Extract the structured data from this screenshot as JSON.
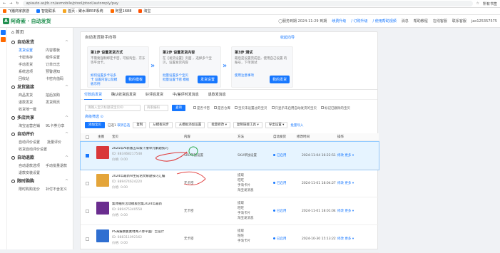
{
  "browser": {
    "url": "apiauto.asjtb.cn/asmobile/ptool/ptool/autoreply/pay",
    "right_label": "所有书签"
  },
  "bookmarks": [
    {
      "label": "飞猪商家旅游",
      "color": "#ff6a00"
    },
    {
      "label": "智能联系",
      "color": "#1677ff"
    },
    {
      "label": "首页 - 聚水潭ERP系统",
      "color": "#f5a623"
    },
    {
      "label": "阿里1688",
      "color": "#ff6a00"
    },
    {
      "label": "淘宝",
      "color": "#ff5000"
    }
  ],
  "app": {
    "logo_text": "阿奇索 · 自动发货",
    "top_links": [
      {
        "label": "◯服务到期 2024-11-29 到期",
        "blue": false
      },
      {
        "label": "续费升级",
        "blue": true
      },
      {
        "label": "/ 订购升级",
        "blue": true
      },
      {
        "label": "/ 使用帮助视频",
        "blue": true
      },
      {
        "label": "消息",
        "blue": false
      },
      {
        "label": "帮助教程",
        "blue": false
      },
      {
        "label": "在线客服",
        "blue": false
      },
      {
        "label": "联系客服",
        "blue": false
      },
      {
        "label": "jao125357575",
        "blue": false
      }
    ]
  },
  "sidebar": {
    "home": "首页",
    "sections": [
      {
        "title": "自动发货",
        "items": [
          "发货设置",
          "内容模板",
          "卡密库存",
          "组件设置",
          "手动发货",
          "订单日志",
          "系统选项",
          "预警通知",
          "回收站",
          "卡密充值码"
        ],
        "active": 0
      },
      {
        "title": "发货链接",
        "items": [
          "商品发货",
          "拍后加购",
          "退款发货",
          "发货网页",
          "收货地一键"
        ],
        "active": -1
      },
      {
        "title": "多店共享",
        "items": [
          "淘宝运营店铺",
          "91卡券分享"
        ],
        "active": -1
      },
      {
        "title": "自动评价",
        "items": [
          "自动评价设置",
          "批量评价",
          "收货自动评价设置"
        ],
        "active": -1
      },
      {
        "title": "自动退款",
        "items": [
          "自动退款选项",
          "手动批量退款",
          "退款安装设置"
        ],
        "active": -1
      },
      {
        "title": "限时购购",
        "items": [
          "限时购购定价",
          "补付不含定义"
        ],
        "active": -1
      }
    ]
  },
  "guide": {
    "title": "自动发货新手向导",
    "fold": "收起向导",
    "steps": [
      {
        "title": "第1步 设置发货方式",
        "desc": "不需要强制绑定卡密，可按淘宝、京东 等平台卡。",
        "link": "如何设置多卡号多卡 设置内容以及模板示例",
        "btn": "我的模板"
      },
      {
        "title": "第2步 设置发货内容",
        "desc": "在【发货设置】页面 ，选择多个宝贝，设置发货内容",
        "link": "批量设置多个宝贝 批量设置卡密 模板",
        "btn": "发货设置"
      },
      {
        "title": "第3步 测试",
        "desc": "最后是设置完成后，使用自己设置 的账号，下单测试",
        "link": "使用注意事项",
        "btn": "我的发货"
      }
    ]
  },
  "tabs": [
    "付款后发货",
    "确认收货后发货",
    "好评后发货",
    "中/差评时发消息",
    "退款发消息"
  ],
  "edit_template": "内容模板",
  "filters": {
    "search1": "请输入宝贝标题或宝贝ID",
    "search2": "商家编码",
    "search_btn": "查询",
    "checks": [
      "是否卡密",
      "是否仓库",
      "宝贝未设置过的宝贝",
      "只显示未启用自动发货的宝贝",
      "标记已删除的宝贝"
    ],
    "more": "高级筛选 ⊙"
  },
  "toolbar": {
    "sync": "添加宝贝",
    "count_label": "已选1",
    "count_link": "取消已选",
    "buttons": [
      "复制",
      "从模板同步",
      "从模板添加设置",
      "批量修改 ▾",
      "复制链接工具 ▾",
      "导出设置 ▾"
    ],
    "import": "批量导入"
  },
  "table": {
    "headers": [
      "主图",
      "宝贝",
      "内容",
      "方法",
      "自动发货",
      "修改时间",
      "操作"
    ],
    "rows": [
      {
        "title": "2025年AI新版五年级下册单元解题技巧",
        "id": "ID: 883468217548",
        "price": "价格: 0.00",
        "content": "SKU单独设置",
        "method": "SKU单独设置",
        "status": "已启用",
        "time": "2024-11-04 16:22:51",
        "ops": "修改  更多 ▾",
        "selected": true,
        "thumb": "#d9383a"
      },
      {
        "title": "2024年最新AI生成语文解题技巧汇编",
        "id": "ID: 889474624220",
        "price": "价格: 0.00",
        "content": "无卡密",
        "method": "提取\n旺旺\n手淘卡片\n淘宝发消息",
        "status": "已启用",
        "time": "2024-11-01 18:04:27",
        "ops": "修改  更多 ▾",
        "selected": false,
        "thumb": "#e4a53a"
      },
      {
        "title": "集体抽奖活动模板合集2024年最新",
        "id": "ID: 889475340558",
        "price": "价格: 0.00",
        "content": "无卡密",
        "method": "提取\n旺旺\n手淘卡片\n淘宝发消息",
        "status": "已启用",
        "time": "2024-11-01 18:01:04",
        "ops": "修改  更多 ▾",
        "selected": false,
        "thumb": "#6a2d8f"
      },
      {
        "title": "PS海报模板素材两人修平面广告设计",
        "id": "ID: 888311092162",
        "price": "价格: 0.00",
        "content": "无卡密",
        "method": "提取\n旺旺\n手淘卡片",
        "status": "已启用",
        "time": "2024-10-30 15:13:22",
        "ops": "修改  更多 ▾",
        "selected": false,
        "thumb": "#2f6fd1"
      }
    ]
  }
}
